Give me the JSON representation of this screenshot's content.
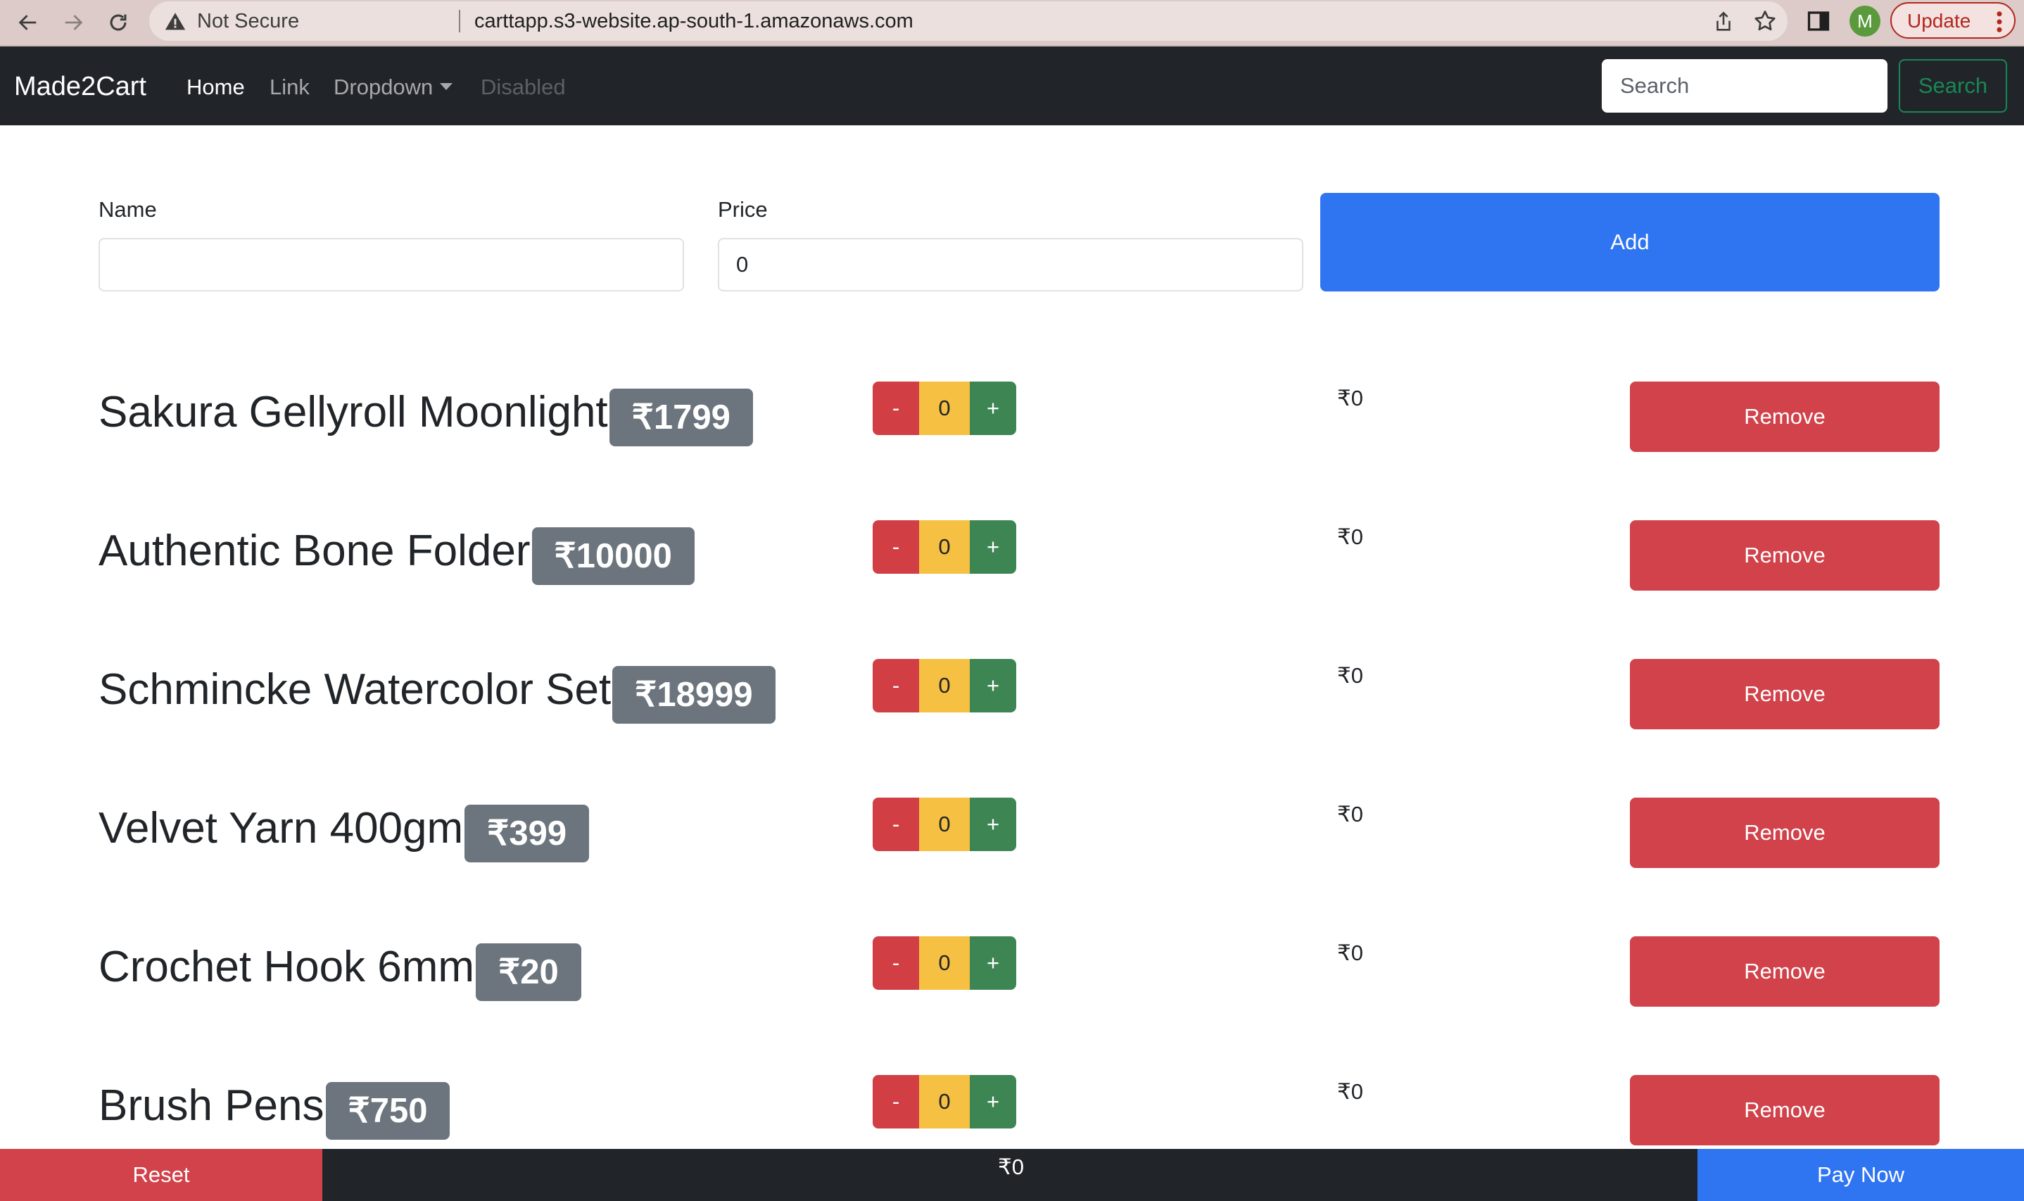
{
  "browser": {
    "security_label": "Not Secure",
    "url": "carttapp.s3-website.ap-south-1.amazonaws.com",
    "profile_initial": "M",
    "update_label": "Update"
  },
  "navbar": {
    "brand": "Made2Cart",
    "links": [
      {
        "label": "Home",
        "state": "active"
      },
      {
        "label": "Link",
        "state": "normal"
      },
      {
        "label": "Dropdown",
        "state": "normal"
      },
      {
        "label": "Disabled",
        "state": "disabled"
      }
    ],
    "search_placeholder": "Search",
    "search_button": "Search"
  },
  "form": {
    "name_label": "Name",
    "name_value": "",
    "price_label": "Price",
    "price_value": "0",
    "add_button": "Add"
  },
  "products": [
    {
      "name": "Sakura Gellyroll Moonlight",
      "price": "₹1799",
      "quantity": "0",
      "total": "₹0",
      "remove_label": "Remove"
    },
    {
      "name": "Authentic Bone Folder",
      "price": "₹10000",
      "quantity": "0",
      "total": "₹0",
      "remove_label": "Remove"
    },
    {
      "name": "Schmincke Watercolor Set",
      "price": "₹18999",
      "quantity": "0",
      "total": "₹0",
      "remove_label": "Remove"
    },
    {
      "name": "Velvet Yarn 400gm",
      "price": "₹399",
      "quantity": "0",
      "total": "₹0",
      "remove_label": "Remove"
    },
    {
      "name": "Crochet Hook 6mm",
      "price": "₹20",
      "quantity": "0",
      "total": "₹0",
      "remove_label": "Remove"
    },
    {
      "name": "Brush Pens",
      "price": "₹750",
      "quantity": "0",
      "total": "₹0",
      "remove_label": "Remove"
    }
  ],
  "qty_controls": {
    "minus": "-",
    "plus": "+"
  },
  "footer": {
    "reset_label": "Reset",
    "cart_total": "₹0",
    "pay_label": "Pay Now"
  },
  "colors": {
    "navbar_bg": "#212529",
    "primary": "#2f74f0",
    "danger": "#d1424a",
    "warning": "#f6c042",
    "success": "#3d8654",
    "badge": "#6c757d"
  }
}
